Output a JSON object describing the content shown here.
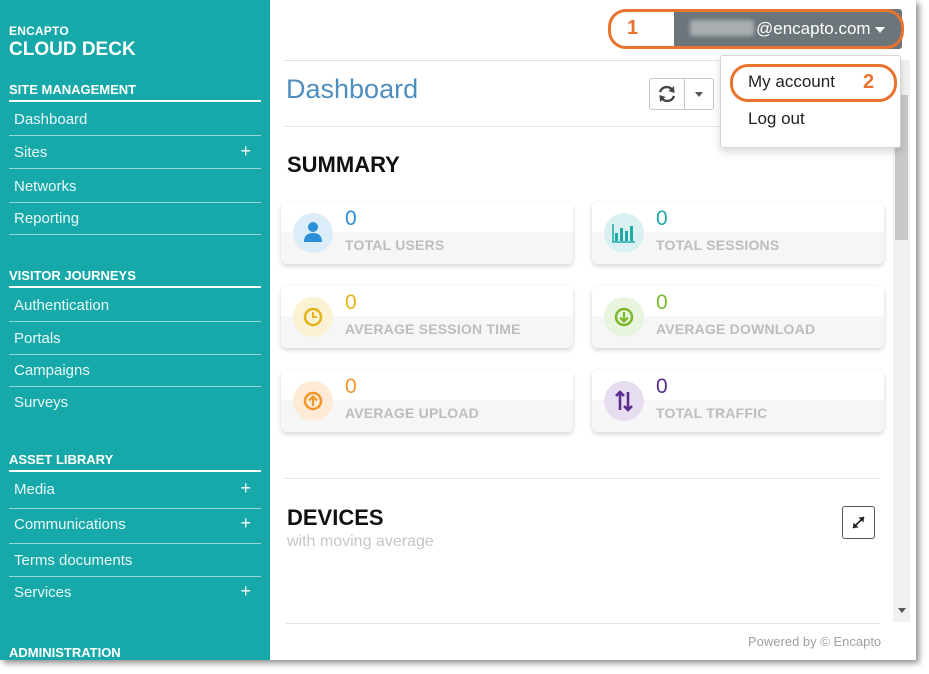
{
  "sidebar": {
    "brand_small": "ENCAPTO",
    "brand_title": "CLOUD DECK",
    "sections": [
      {
        "title": "SITE MANAGEMENT",
        "items": [
          {
            "label": "Dashboard",
            "expand": ""
          },
          {
            "label": "Sites",
            "expand": "+"
          },
          {
            "label": "Networks",
            "expand": ""
          },
          {
            "label": "Reporting",
            "expand": ""
          }
        ]
      },
      {
        "title": "VISITOR JOURNEYS",
        "items": [
          {
            "label": "Authentication",
            "expand": ""
          },
          {
            "label": "Portals",
            "expand": ""
          },
          {
            "label": "Campaigns",
            "expand": ""
          },
          {
            "label": "Surveys",
            "expand": ""
          }
        ]
      },
      {
        "title": "ASSET LIBRARY",
        "items": [
          {
            "label": "Media",
            "expand": "+"
          },
          {
            "label": "Communications",
            "expand": "+"
          },
          {
            "label": "Terms documents",
            "expand": ""
          },
          {
            "label": "Services",
            "expand": "+"
          }
        ]
      },
      {
        "title": "ADMINISTRATION",
        "items": []
      }
    ]
  },
  "header": {
    "account_email": "@encapto.com",
    "page_title": "Dashboard"
  },
  "account_menu": {
    "items": [
      "My account",
      "Log out"
    ]
  },
  "callouts": [
    "1",
    "2"
  ],
  "summary": {
    "title": "SUMMARY",
    "cards": [
      {
        "value": "0",
        "label": "TOTAL USERS",
        "icon": "user-icon",
        "color": "#2b8fd8",
        "bg": "#dcedfa"
      },
      {
        "value": "0",
        "label": "TOTAL SESSIONS",
        "icon": "bar-chart-icon",
        "color": "#21a9a6",
        "bg": "#d9f1f0"
      },
      {
        "value": "0",
        "label": "AVERAGE SESSION TIME",
        "icon": "clock-icon",
        "color": "#e3b51a",
        "bg": "#fbf1d3"
      },
      {
        "value": "0",
        "label": "AVERAGE DOWNLOAD",
        "icon": "download-icon",
        "color": "#7cb82f",
        "bg": "#e9f4dc"
      },
      {
        "value": "0",
        "label": "AVERAGE UPLOAD",
        "icon": "upload-icon",
        "color": "#f0962a",
        "bg": "#fdebd6"
      },
      {
        "value": "0",
        "label": "TOTAL TRAFFIC",
        "icon": "traffic-icon",
        "color": "#5b2d8e",
        "bg": "#e7ddf1"
      }
    ]
  },
  "devices": {
    "title": "DEVICES",
    "subtitle": "with moving average"
  },
  "footer": "Powered by © Encapto",
  "colors": {
    "sidebar": "#17a9a9",
    "accent": "#e8722e",
    "title": "#4f8fbf"
  }
}
